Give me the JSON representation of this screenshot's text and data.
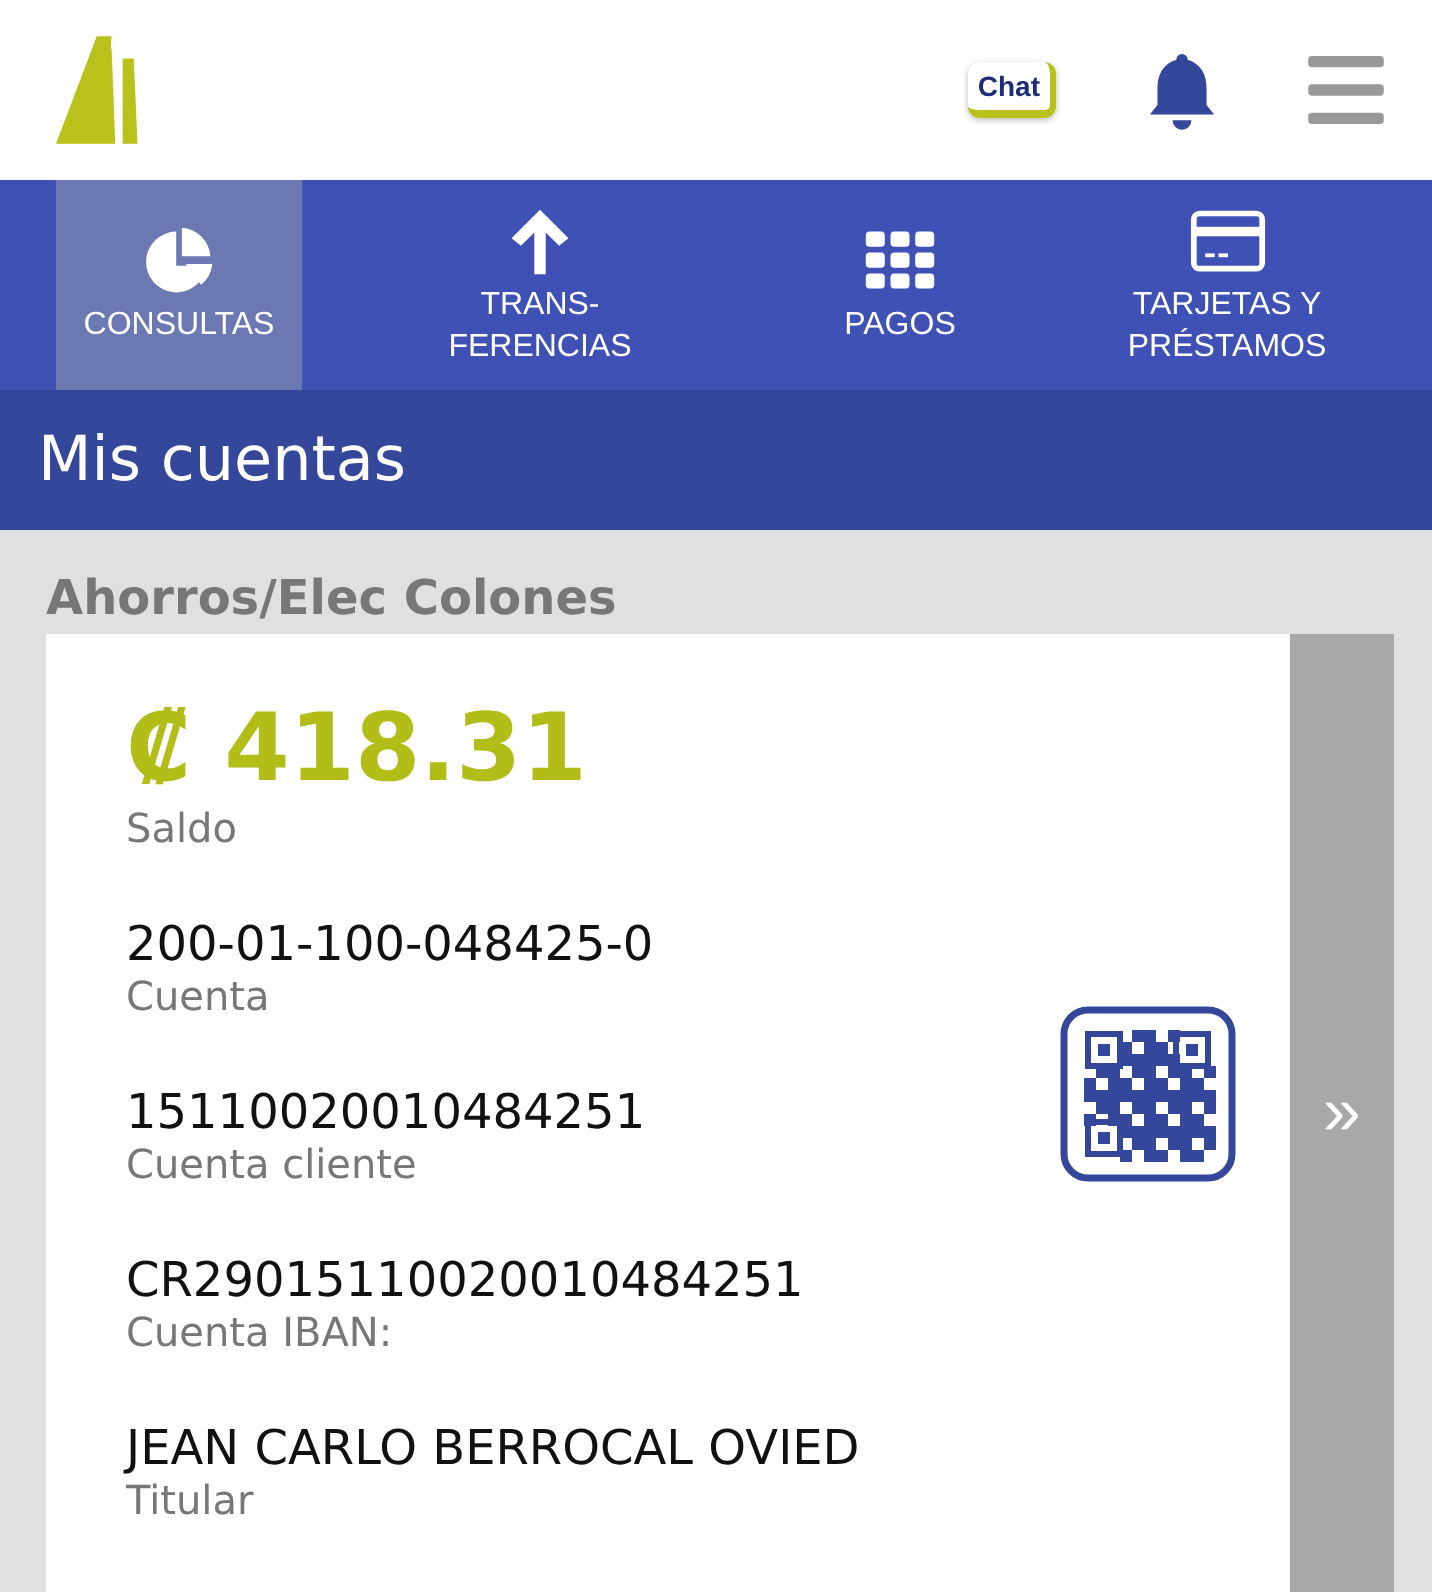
{
  "header": {
    "chat_label": "Chat"
  },
  "tabs": [
    {
      "kind": "chart",
      "lines": [
        "CONSULTAS"
      ],
      "selected": true
    },
    {
      "kind": "transfer",
      "lines": [
        "TRANS-",
        "FERENCIAS"
      ],
      "selected": false
    },
    {
      "kind": "grid",
      "lines": [
        "PAGOS"
      ],
      "selected": false
    },
    {
      "kind": "card",
      "lines": [
        "TARJETAS Y",
        "PRÉSTAMOS"
      ],
      "selected": false
    }
  ],
  "page_title": "Mis cuentas",
  "account": {
    "type": "Ahorros/Elec Colones",
    "balance": "₡ 418.31",
    "balance_label": "Saldo",
    "fields": [
      {
        "value": "200-01-100-048425-0",
        "label": "Cuenta"
      },
      {
        "value": "15110020010484251",
        "label": "Cuenta cliente"
      },
      {
        "value": "CR29015110020010484251",
        "label": "Cuenta IBAN:"
      },
      {
        "value": "JEAN CARLO BERROCAL OVIED",
        "label": "Titular"
      }
    ],
    "next_label": "»"
  }
}
